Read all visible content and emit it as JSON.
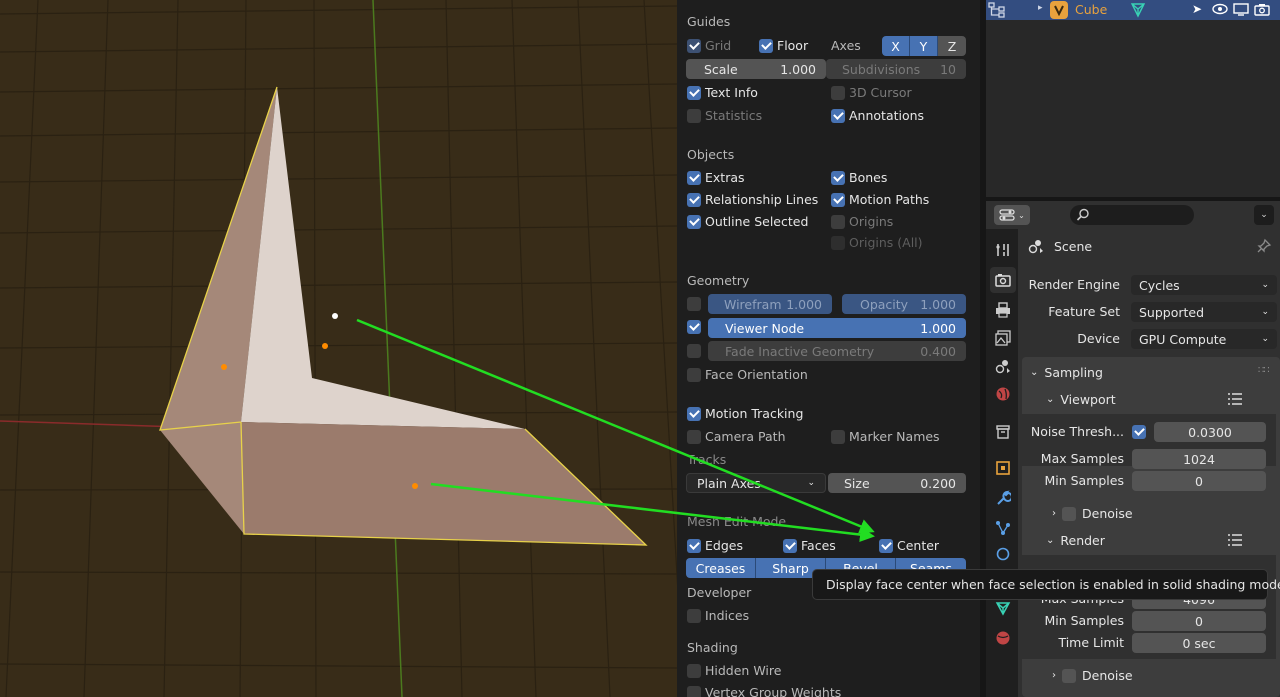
{
  "overlays": {
    "guides": {
      "title": "Guides",
      "grid": "Grid",
      "floor": "Floor",
      "axes": "Axes",
      "axis_x": "X",
      "axis_y": "Y",
      "axis_z": "Z",
      "scale_label": "Scale",
      "scale_value": "1.000",
      "subdivisions_label": "Subdivisions",
      "subdivisions_value": "10",
      "text_info": "Text Info",
      "cursor_3d": "3D Cursor",
      "statistics": "Statistics",
      "annotations": "Annotations"
    },
    "objects": {
      "title": "Objects",
      "extras": "Extras",
      "bones": "Bones",
      "relationship_lines": "Relationship Lines",
      "motion_paths": "Motion Paths",
      "outline_selected": "Outline Selected",
      "origins": "Origins",
      "origins_all": "Origins (All)"
    },
    "geometry": {
      "title": "Geometry",
      "wireframe_label": "Wirefram",
      "wireframe_value": "1.000",
      "opacity_label": "Opacity",
      "opacity_value": "1.000",
      "viewer_node_label": "Viewer Node",
      "viewer_node_value": "1.000",
      "fade_label": "Fade Inactive Geometry",
      "fade_value": "0.400",
      "face_orientation": "Face Orientation"
    },
    "motion_tracking": {
      "title": "Motion Tracking",
      "camera_path": "Camera Path",
      "marker_names": "Marker Names",
      "tracks_label": "Tracks",
      "tracks_value": "Plain Axes",
      "size_label": "Size",
      "size_value": "0.200"
    },
    "mesh_edit": {
      "title": "Mesh Edit Mode",
      "edges": "Edges",
      "faces": "Faces",
      "center": "Center",
      "creases": "Creases",
      "sharp": "Sharp",
      "bevel": "Bevel",
      "seams": "Seams"
    },
    "developer": {
      "title": "Developer",
      "indices": "Indices"
    },
    "shading": {
      "title": "Shading",
      "hidden_wire": "Hidden Wire",
      "vertex_group_weights": "Vertex Group Weights"
    }
  },
  "tooltip": "Display face center when face selection is enabled in solid shading modes.",
  "outliner": {
    "object_name": "Cube"
  },
  "properties": {
    "search_placeholder": "",
    "scene_title": "Scene",
    "render_engine_label": "Render Engine",
    "render_engine_value": "Cycles",
    "feature_set_label": "Feature Set",
    "feature_set_value": "Supported",
    "device_label": "Device",
    "device_value": "GPU Compute",
    "sampling": "Sampling",
    "viewport": "Viewport",
    "noise_threshold_label": "Noise Thresh...",
    "noise_threshold_value": "0.0300",
    "max_samples_label": "Max Samples",
    "max_samples_value": "1024",
    "min_samples_label": "Min Samples",
    "min_samples_value": "0",
    "denoise": "Denoise",
    "render": "Render",
    "render_max_samples_label": "Max Samples",
    "render_max_samples_value": "4096",
    "render_min_samples_label": "Min Samples",
    "render_min_samples_value": "0",
    "time_limit_label": "Time Limit",
    "time_limit_value": "0 sec",
    "render_denoise": "Denoise"
  },
  "colors": {
    "accent_blue": "#4772b3",
    "arrow_green": "#22dd22",
    "viewport_bg": "#382c18",
    "selection_yellow": "#e8d24a",
    "face_orange": "#ff8c00"
  }
}
